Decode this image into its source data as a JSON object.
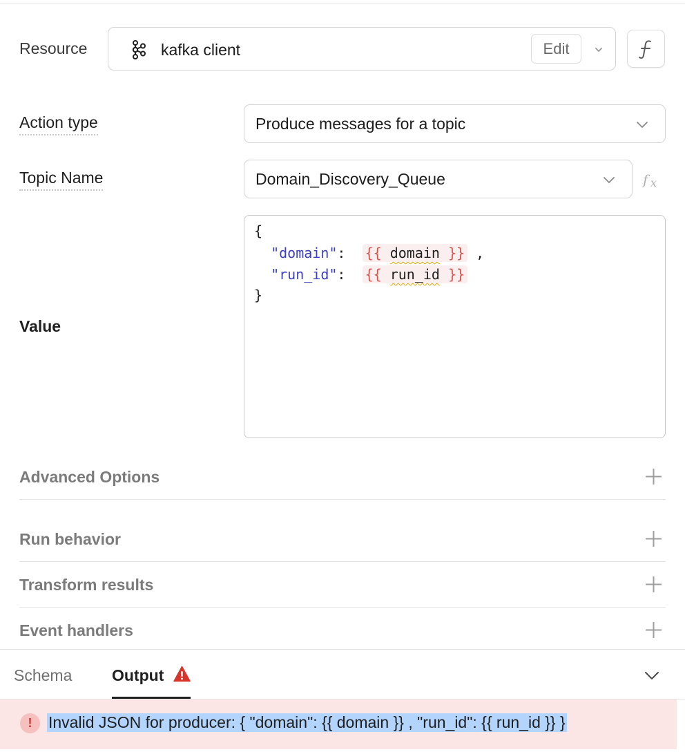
{
  "resource": {
    "label": "Resource",
    "value": "kafka client",
    "edit_label": "Edit",
    "icon": "kafka-icon"
  },
  "action_type": {
    "label": "Action type",
    "value": "Produce messages for a topic"
  },
  "topic_name": {
    "label": "Topic Name",
    "value": "Domain_Discovery_Queue"
  },
  "value_field": {
    "label": "Value",
    "lines": [
      {
        "open": "{"
      },
      {
        "key": "\"domain\"",
        "colon": ":",
        "tpl_open": "{{",
        "var": "domain",
        "tpl_close": "}}",
        "trail": ","
      },
      {
        "key": "\"run_id\"",
        "colon": ":",
        "tpl_open": "{{",
        "var": "run_id",
        "tpl_close": "}}",
        "trail": ""
      },
      {
        "close": "}"
      }
    ]
  },
  "sections": {
    "advanced_options": "Advanced Options",
    "run_behavior": "Run behavior",
    "transform_results": "Transform results",
    "event_handlers": "Event handlers"
  },
  "bottom_tabs": {
    "schema": "Schema",
    "output": "Output"
  },
  "error": {
    "icon_glyph": "!",
    "message": "Invalid JSON for producer: { \"domain\": {{ domain }} , \"run_id\": {{ run_id }} }"
  },
  "colors": {
    "error_bg": "#fbe6e5",
    "warning": "#d9342b",
    "json_key": "#3c3fbf",
    "template_brace": "#d9534f",
    "selection": "#b3d4fc"
  }
}
